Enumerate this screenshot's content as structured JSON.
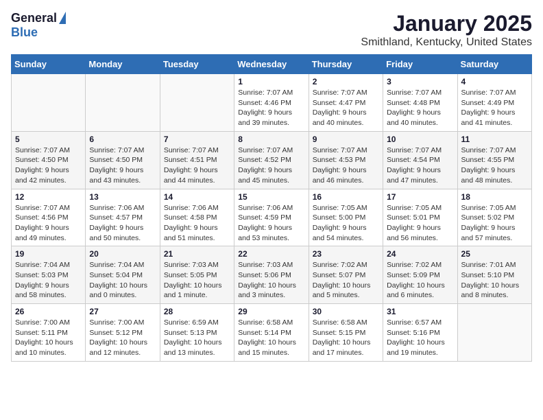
{
  "header": {
    "logo_general": "General",
    "logo_blue": "Blue",
    "title": "January 2025",
    "subtitle": "Smithland, Kentucky, United States"
  },
  "days_of_week": [
    "Sunday",
    "Monday",
    "Tuesday",
    "Wednesday",
    "Thursday",
    "Friday",
    "Saturday"
  ],
  "weeks": [
    [
      {
        "day": "",
        "info": ""
      },
      {
        "day": "",
        "info": ""
      },
      {
        "day": "",
        "info": ""
      },
      {
        "day": "1",
        "info": "Sunrise: 7:07 AM\nSunset: 4:46 PM\nDaylight: 9 hours\nand 39 minutes."
      },
      {
        "day": "2",
        "info": "Sunrise: 7:07 AM\nSunset: 4:47 PM\nDaylight: 9 hours\nand 40 minutes."
      },
      {
        "day": "3",
        "info": "Sunrise: 7:07 AM\nSunset: 4:48 PM\nDaylight: 9 hours\nand 40 minutes."
      },
      {
        "day": "4",
        "info": "Sunrise: 7:07 AM\nSunset: 4:49 PM\nDaylight: 9 hours\nand 41 minutes."
      }
    ],
    [
      {
        "day": "5",
        "info": "Sunrise: 7:07 AM\nSunset: 4:50 PM\nDaylight: 9 hours\nand 42 minutes."
      },
      {
        "day": "6",
        "info": "Sunrise: 7:07 AM\nSunset: 4:50 PM\nDaylight: 9 hours\nand 43 minutes."
      },
      {
        "day": "7",
        "info": "Sunrise: 7:07 AM\nSunset: 4:51 PM\nDaylight: 9 hours\nand 44 minutes."
      },
      {
        "day": "8",
        "info": "Sunrise: 7:07 AM\nSunset: 4:52 PM\nDaylight: 9 hours\nand 45 minutes."
      },
      {
        "day": "9",
        "info": "Sunrise: 7:07 AM\nSunset: 4:53 PM\nDaylight: 9 hours\nand 46 minutes."
      },
      {
        "day": "10",
        "info": "Sunrise: 7:07 AM\nSunset: 4:54 PM\nDaylight: 9 hours\nand 47 minutes."
      },
      {
        "day": "11",
        "info": "Sunrise: 7:07 AM\nSunset: 4:55 PM\nDaylight: 9 hours\nand 48 minutes."
      }
    ],
    [
      {
        "day": "12",
        "info": "Sunrise: 7:07 AM\nSunset: 4:56 PM\nDaylight: 9 hours\nand 49 minutes."
      },
      {
        "day": "13",
        "info": "Sunrise: 7:06 AM\nSunset: 4:57 PM\nDaylight: 9 hours\nand 50 minutes."
      },
      {
        "day": "14",
        "info": "Sunrise: 7:06 AM\nSunset: 4:58 PM\nDaylight: 9 hours\nand 51 minutes."
      },
      {
        "day": "15",
        "info": "Sunrise: 7:06 AM\nSunset: 4:59 PM\nDaylight: 9 hours\nand 53 minutes."
      },
      {
        "day": "16",
        "info": "Sunrise: 7:05 AM\nSunset: 5:00 PM\nDaylight: 9 hours\nand 54 minutes."
      },
      {
        "day": "17",
        "info": "Sunrise: 7:05 AM\nSunset: 5:01 PM\nDaylight: 9 hours\nand 56 minutes."
      },
      {
        "day": "18",
        "info": "Sunrise: 7:05 AM\nSunset: 5:02 PM\nDaylight: 9 hours\nand 57 minutes."
      }
    ],
    [
      {
        "day": "19",
        "info": "Sunrise: 7:04 AM\nSunset: 5:03 PM\nDaylight: 9 hours\nand 58 minutes."
      },
      {
        "day": "20",
        "info": "Sunrise: 7:04 AM\nSunset: 5:04 PM\nDaylight: 10 hours\nand 0 minutes."
      },
      {
        "day": "21",
        "info": "Sunrise: 7:03 AM\nSunset: 5:05 PM\nDaylight: 10 hours\nand 1 minute."
      },
      {
        "day": "22",
        "info": "Sunrise: 7:03 AM\nSunset: 5:06 PM\nDaylight: 10 hours\nand 3 minutes."
      },
      {
        "day": "23",
        "info": "Sunrise: 7:02 AM\nSunset: 5:07 PM\nDaylight: 10 hours\nand 5 minutes."
      },
      {
        "day": "24",
        "info": "Sunrise: 7:02 AM\nSunset: 5:09 PM\nDaylight: 10 hours\nand 6 minutes."
      },
      {
        "day": "25",
        "info": "Sunrise: 7:01 AM\nSunset: 5:10 PM\nDaylight: 10 hours\nand 8 minutes."
      }
    ],
    [
      {
        "day": "26",
        "info": "Sunrise: 7:00 AM\nSunset: 5:11 PM\nDaylight: 10 hours\nand 10 minutes."
      },
      {
        "day": "27",
        "info": "Sunrise: 7:00 AM\nSunset: 5:12 PM\nDaylight: 10 hours\nand 12 minutes."
      },
      {
        "day": "28",
        "info": "Sunrise: 6:59 AM\nSunset: 5:13 PM\nDaylight: 10 hours\nand 13 minutes."
      },
      {
        "day": "29",
        "info": "Sunrise: 6:58 AM\nSunset: 5:14 PM\nDaylight: 10 hours\nand 15 minutes."
      },
      {
        "day": "30",
        "info": "Sunrise: 6:58 AM\nSunset: 5:15 PM\nDaylight: 10 hours\nand 17 minutes."
      },
      {
        "day": "31",
        "info": "Sunrise: 6:57 AM\nSunset: 5:16 PM\nDaylight: 10 hours\nand 19 minutes."
      },
      {
        "day": "",
        "info": ""
      }
    ]
  ]
}
